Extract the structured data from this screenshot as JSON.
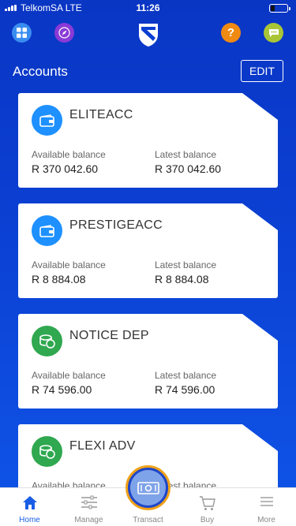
{
  "status_bar": {
    "carrier": "TelkomSA  LTE",
    "time": "11:26"
  },
  "header": {
    "left_icons": [
      "apps-grid-icon",
      "compass-icon"
    ],
    "logo": "bank-shield-logo",
    "help_label": "?",
    "right_icons": [
      "help-icon",
      "chat-icon"
    ]
  },
  "accounts": {
    "title": "Accounts",
    "edit_label": "EDIT",
    "available_label": "Available balance",
    "latest_label": "Latest balance",
    "items": [
      {
        "name": "ELITEACC",
        "icon": "wallet-icon",
        "available": "R 370 042.60",
        "latest": "R 370 042.60"
      },
      {
        "name": "PRESTIGEACC",
        "icon": "wallet-icon",
        "available": "R 8 884.08",
        "latest": "R 8 884.08"
      },
      {
        "name": "NOTICE DEP",
        "icon": "coins-icon",
        "available": "R 74 596.00",
        "latest": "R 74 596.00"
      },
      {
        "name": "FLEXI ADV",
        "icon": "coins-icon",
        "available": "",
        "latest": ""
      }
    ]
  },
  "nav": {
    "items": [
      {
        "label": "Home",
        "icon": "home-icon",
        "active": true
      },
      {
        "label": "Manage",
        "icon": "sliders-icon",
        "active": false
      },
      {
        "label": "Transact",
        "icon": "cash-icon",
        "active": false
      },
      {
        "label": "Buy",
        "icon": "cart-icon",
        "active": false
      },
      {
        "label": "More",
        "icon": "menu-icon",
        "active": false
      }
    ]
  },
  "colors": {
    "background": "#0b3fd2",
    "active_nav": "#1a5ee6",
    "fab_ring": "#f0a21a"
  }
}
